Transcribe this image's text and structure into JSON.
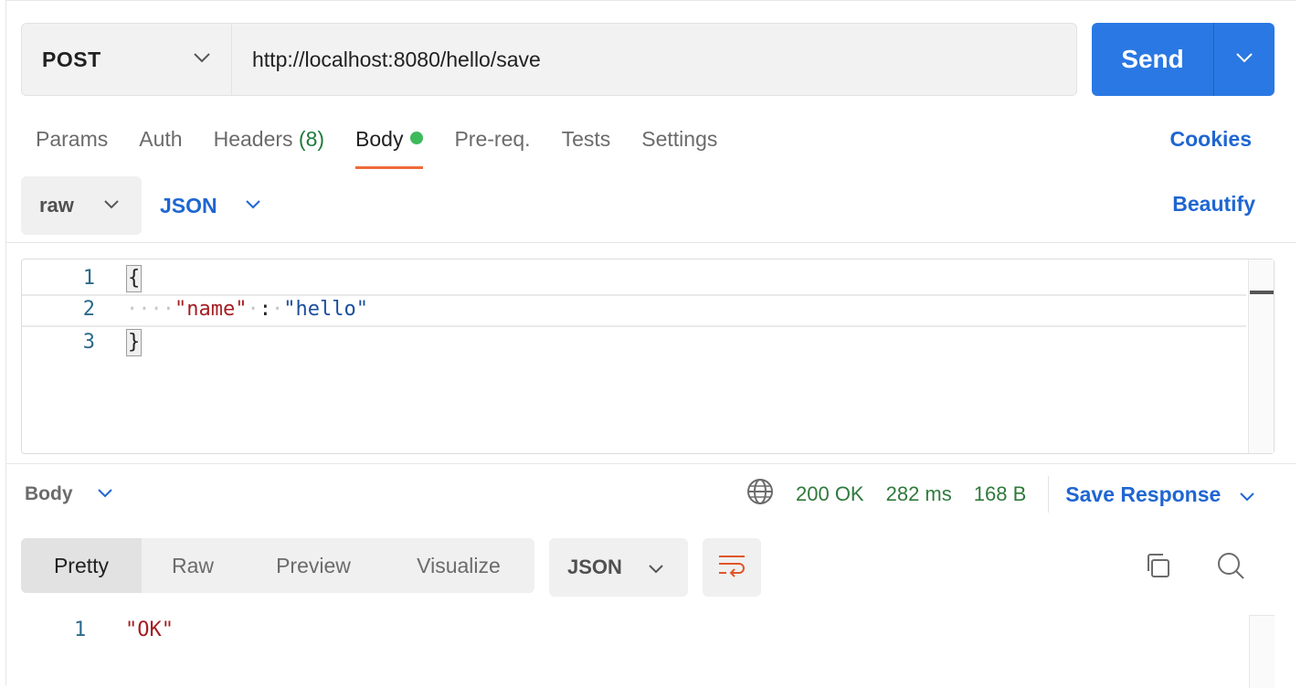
{
  "request": {
    "method": "POST",
    "url": "http://localhost:8080/hello/save",
    "send_label": "Send"
  },
  "tabs": {
    "params": "Params",
    "auth": "Auth",
    "headers": "Headers",
    "headers_count": "(8)",
    "body": "Body",
    "prereq": "Pre-req.",
    "tests": "Tests",
    "settings": "Settings",
    "cookies": "Cookies"
  },
  "body_options": {
    "mode": "raw",
    "language": "JSON",
    "beautify": "Beautify"
  },
  "editor": {
    "lines": [
      {
        "num": "1",
        "open": "{"
      },
      {
        "num": "2",
        "key": "\"name\"",
        "colon": ":",
        "value": "\"hello\""
      },
      {
        "num": "3",
        "close": "}"
      }
    ]
  },
  "response": {
    "section_label": "Body",
    "status": "200 OK",
    "time": "282 ms",
    "size": "168 B",
    "save_label": "Save Response",
    "view_tabs": [
      "Pretty",
      "Raw",
      "Preview",
      "Visualize"
    ],
    "format": "JSON",
    "line_num": "1",
    "content": "\"OK\""
  },
  "colors": {
    "accent": "#2a78e3",
    "link": "#1f66d1",
    "success": "#2f7a3c",
    "tab_underline": "#ef6a3a",
    "body_dot": "#3dba5b"
  }
}
